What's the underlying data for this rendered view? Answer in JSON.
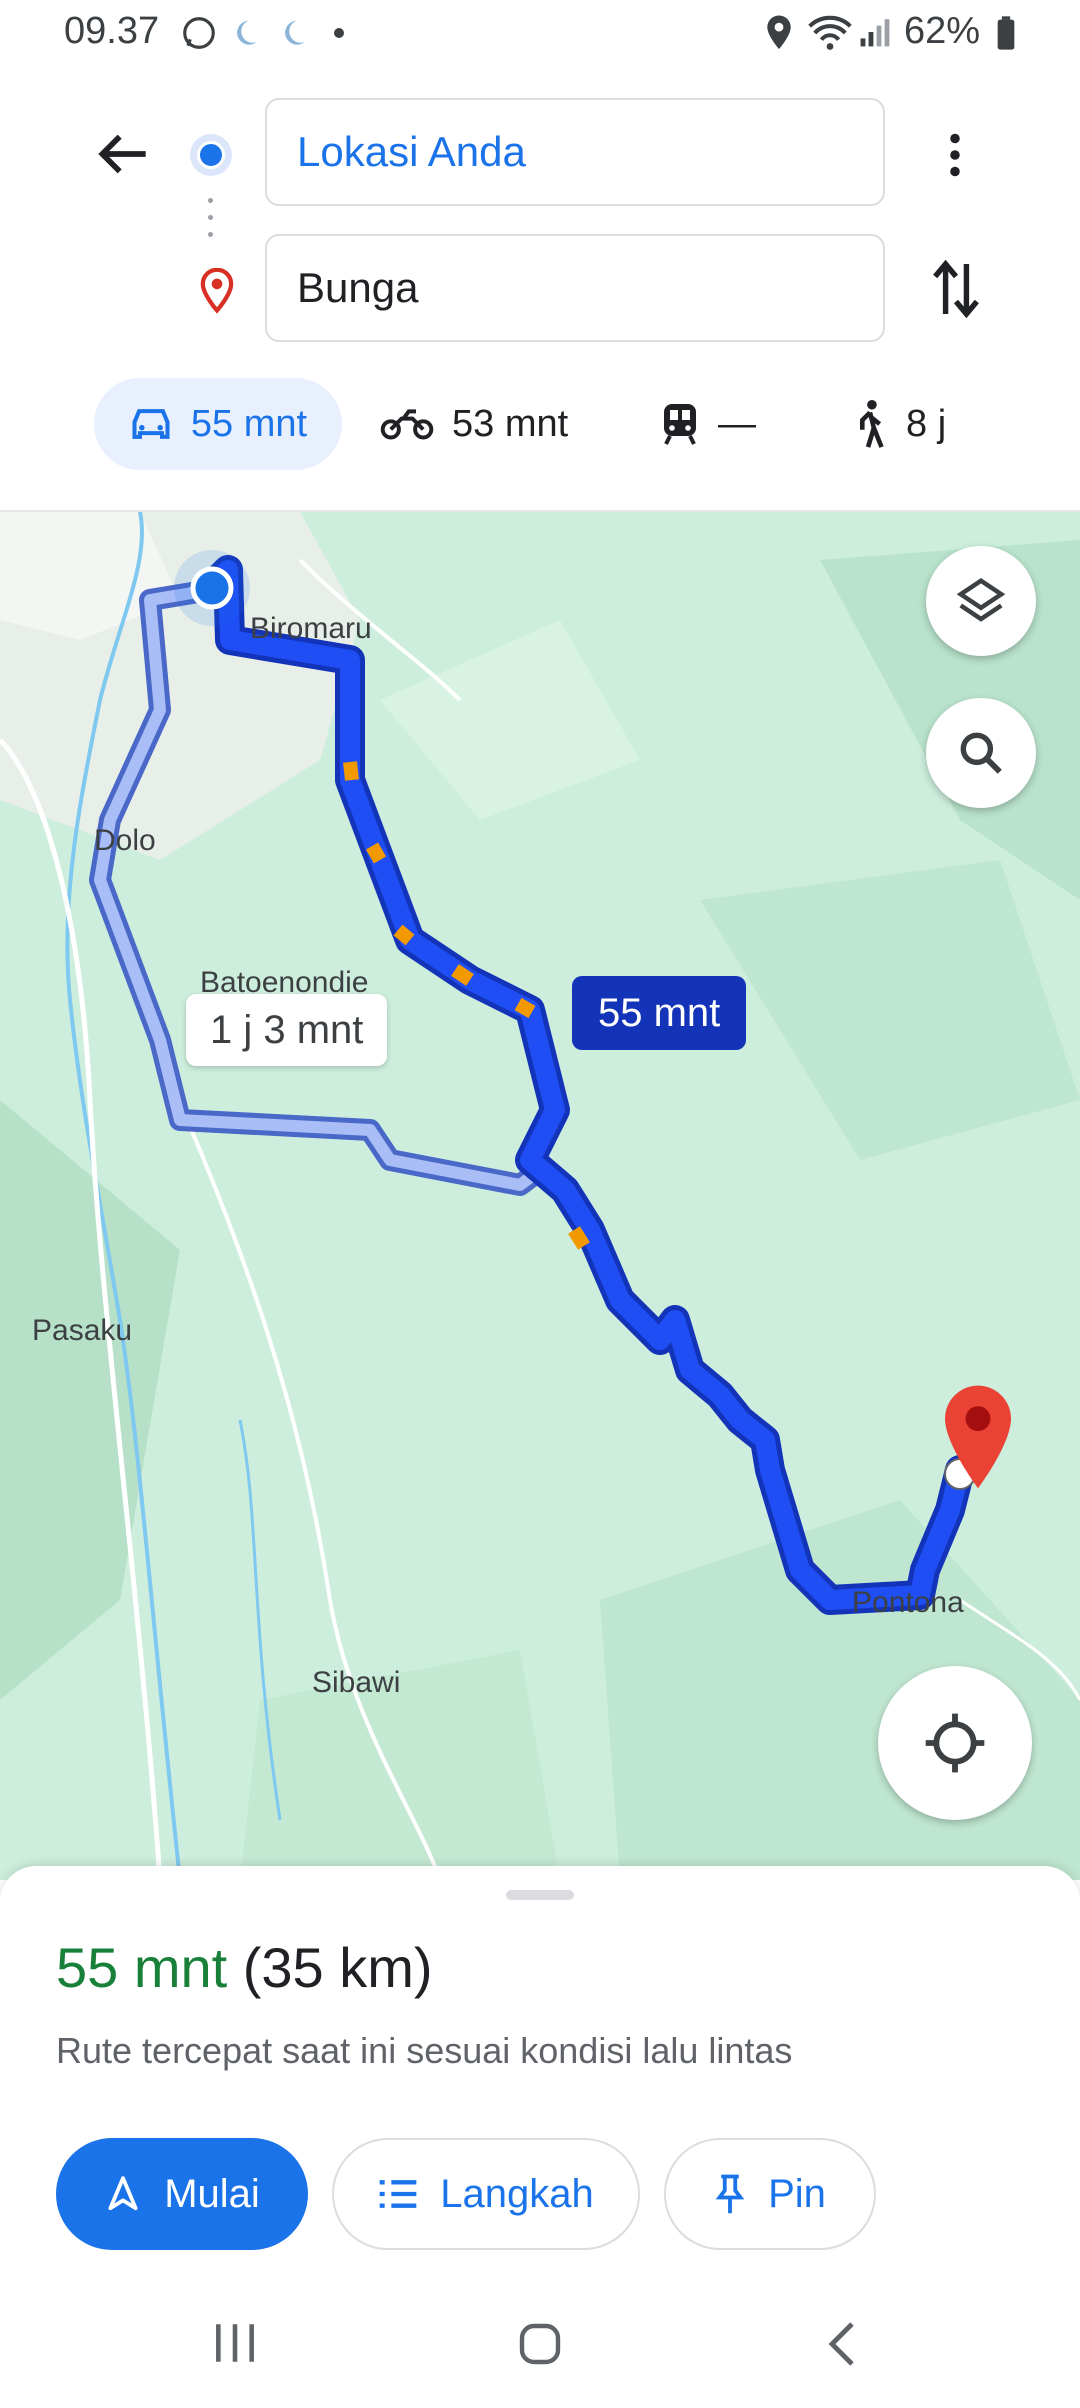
{
  "status_bar": {
    "time": "09.37",
    "battery": "62%"
  },
  "header": {
    "origin_value": "Lokasi Anda",
    "destination_value": "Bunga"
  },
  "modes": [
    {
      "name": "car",
      "label": "55 mnt",
      "active": true
    },
    {
      "name": "motorcycle",
      "label": "53 mnt"
    },
    {
      "name": "transit",
      "label": "—"
    },
    {
      "name": "walk",
      "label": "8 j"
    }
  ],
  "map": {
    "places": [
      "Biromaru",
      "Dolo",
      "Batoenondie",
      "Pasaku",
      "Sibawi",
      "Pontona"
    ],
    "primary_route_label": "55 mnt",
    "alt_route_label": "1 j 3 mnt"
  },
  "sheet": {
    "duration": "55 mnt",
    "distance": "(35 km)",
    "subtitle": "Rute tercepat saat ini sesuai kondisi lalu lintas",
    "buttons": {
      "start": "Mulai",
      "steps": "Langkah",
      "pin": "Pin"
    }
  },
  "colors": {
    "accent": "#1a73e8",
    "route": "#1a3fe8",
    "duration_green": "#188038",
    "map_bg": "#cdeedd"
  }
}
